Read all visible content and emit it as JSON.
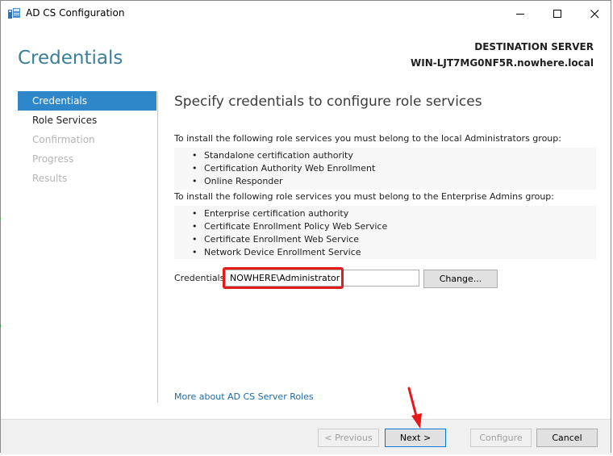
{
  "window": {
    "title": "AD CS Configuration",
    "minimize_icon": "minimize-icon",
    "maximize_icon": "maximize-icon",
    "close_icon": "close-icon"
  },
  "header": {
    "page_title": "Credentials",
    "destination_label": "DESTINATION SERVER",
    "destination_server": "WIN-LJT7MG0NF5R.nowhere.local"
  },
  "nav": {
    "items": [
      {
        "label": "Credentials",
        "state": "active"
      },
      {
        "label": "Role Services",
        "state": "enabled"
      },
      {
        "label": "Confirmation",
        "state": "disabled"
      },
      {
        "label": "Progress",
        "state": "disabled"
      },
      {
        "label": "Results",
        "state": "disabled"
      }
    ]
  },
  "main": {
    "heading": "Specify credentials to configure role services",
    "local_admin_intro": "To install the following role services you must belong to the local Administrators group:",
    "local_admin_services": [
      "Standalone certification authority",
      "Certification Authority Web Enrollment",
      "Online Responder"
    ],
    "enterprise_admin_intro": "To install the following role services you must belong to the Enterprise Admins group:",
    "enterprise_admin_services": [
      "Enterprise certification authority",
      "Certificate Enrollment Policy Web Service",
      "Certificate Enrollment Web Service",
      "Network Device Enrollment Service"
    ],
    "credentials_label": "Credentials:",
    "credentials_value": "NOWHERE\\Administrator",
    "change_button": "Change...",
    "more_link": "More about AD CS Server Roles"
  },
  "footer": {
    "previous_button": "< Previous",
    "next_button": "Next >",
    "configure_button": "Configure",
    "cancel_button": "Cancel"
  },
  "colors": {
    "accent": "#2e87c8",
    "title_teal": "#3a7f95",
    "annotation_red": "#e41b1b"
  }
}
